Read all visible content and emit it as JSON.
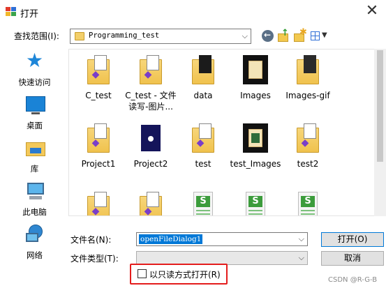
{
  "window": {
    "title": "打开",
    "close_glyph": "✕"
  },
  "lookin": {
    "label": "查找范围(I):",
    "value": "Programming_test"
  },
  "toolbar": {
    "back_icon": "back-arrow-icon",
    "up_icon": "folder-up-icon",
    "new_icon": "new-folder-icon",
    "view_icon": "view-menu-icon"
  },
  "places": [
    {
      "label": "快速访问",
      "icon": "quick-access-star-icon"
    },
    {
      "label": "桌面",
      "icon": "desktop-icon"
    },
    {
      "label": "库",
      "icon": "library-icon"
    },
    {
      "label": "此电脑",
      "icon": "this-pc-icon"
    },
    {
      "label": "网络",
      "icon": "network-icon"
    }
  ],
  "files": [
    {
      "name": "C_test",
      "name2": "",
      "type": "vs-folder"
    },
    {
      "name": "C_test - 文件",
      "name2": "读写-图片...",
      "type": "vs-folder"
    },
    {
      "name": "data",
      "name2": "",
      "type": "image-folder"
    },
    {
      "name": "Images",
      "name2": "",
      "type": "photo-folder"
    },
    {
      "name": "Images-gif",
      "name2": "",
      "type": "folder"
    },
    {
      "name": "Project1",
      "name2": "",
      "type": "vs-folder"
    },
    {
      "name": "Project2",
      "name2": "",
      "type": "navy-folder"
    },
    {
      "name": "test",
      "name2": "",
      "type": "vs-folder"
    },
    {
      "name": "test_Images",
      "name2": "",
      "type": "photo-folder"
    },
    {
      "name": "test2",
      "name2": "",
      "type": "vs-folder"
    },
    {
      "name": "",
      "name2": "",
      "type": "vs-folder"
    },
    {
      "name": "",
      "name2": "",
      "type": "vs-folder"
    },
    {
      "name": "",
      "name2": "",
      "type": "excel-file"
    },
    {
      "name": "",
      "name2": "",
      "type": "excel-file"
    },
    {
      "name": "",
      "name2": "",
      "type": "excel-file"
    }
  ],
  "filename": {
    "label": "文件名(N):",
    "value": "openFileDialog1"
  },
  "filetype": {
    "label": "文件类型(T):",
    "value": ""
  },
  "buttons": {
    "open": "打开(O)",
    "cancel": "取消"
  },
  "readonly": {
    "label": "以只读方式打开(R)"
  },
  "watermark": "CSDN @R-G-B"
}
